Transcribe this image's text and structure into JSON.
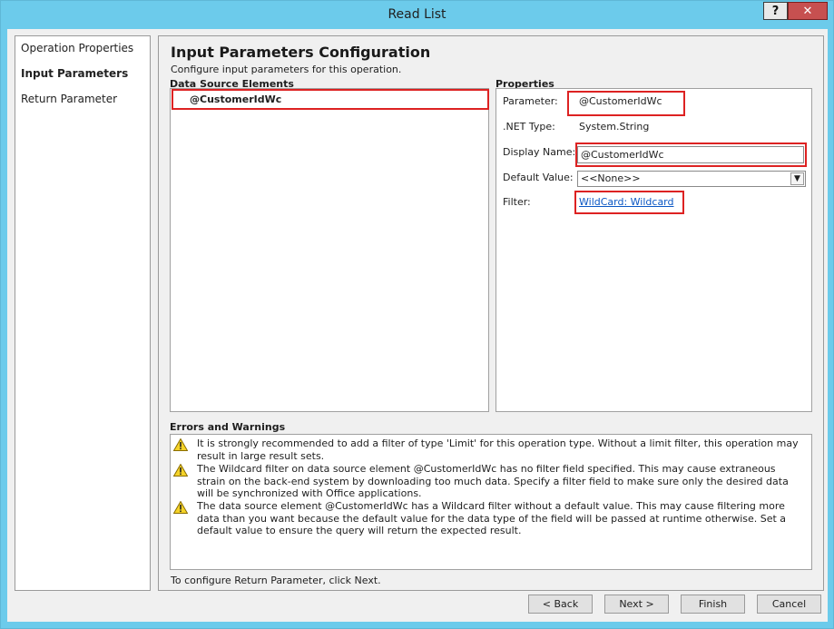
{
  "window": {
    "title": "Read List",
    "help_label": "?",
    "close_label": "✕"
  },
  "nav": {
    "items": [
      {
        "label": "Operation Properties"
      },
      {
        "label": "Input Parameters"
      },
      {
        "label": "Return Parameter"
      }
    ],
    "active_index": 1
  },
  "main": {
    "title": "Input Parameters Configuration",
    "description": "Configure input parameters for this operation.",
    "data_source_label": "Data Source Elements",
    "data_source_items": [
      "@CustomerIdWc"
    ],
    "properties_label": "Properties",
    "properties": {
      "parameter_label": "Parameter:",
      "parameter_value": "@CustomerIdWc",
      "net_type_label": ".NET Type:",
      "net_type_value": "System.String",
      "display_name_label": "Display Name:",
      "display_name_value": "@CustomerIdWc",
      "default_value_label": "Default Value:",
      "default_value_selected": "<<None>>",
      "filter_label": "Filter:",
      "filter_link": "WildCard: Wildcard"
    },
    "errors_label": "Errors and Warnings",
    "warnings": [
      "It is strongly recommended to add a filter of type 'Limit' for this operation type. Without a limit filter, this operation may result in large result sets.",
      "The Wildcard filter on data source element @CustomerIdWc has no filter field specified. This may cause extraneous strain on the back-end system by downloading too much data. Specify a filter field to make sure only the desired data will be synchronized with Office applications.",
      "The data source element @CustomerIdWc has a Wildcard filter without a default value. This may cause filtering more data than you want because the default value for the data type of the field will be passed at runtime otherwise. Set a default value to ensure the query will return the expected result."
    ],
    "footer_note": "To configure Return Parameter, click Next."
  },
  "buttons": {
    "back": "< Back",
    "next": "Next >",
    "finish": "Finish",
    "cancel": "Cancel"
  },
  "colors": {
    "title_bar": "#6ccbeb",
    "close_button": "#c75050",
    "highlight": "#dd2222",
    "link": "#0b57c4"
  }
}
